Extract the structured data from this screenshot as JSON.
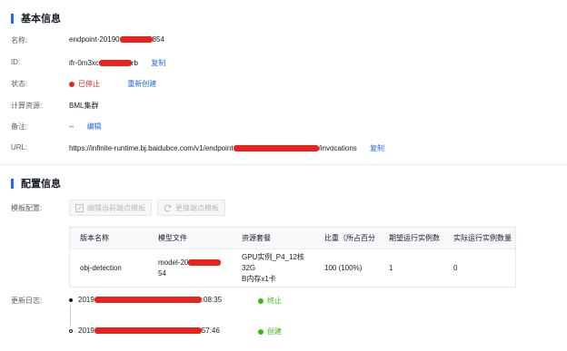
{
  "basic": {
    "title": "基本信息",
    "name_label": "名称:",
    "name_prefix": "endpoint-20190",
    "name_suffix": "854",
    "id_label": "ID:",
    "id_prefix": "ifr-0m3xc",
    "id_suffix": "rb",
    "copy_label": "复制",
    "status_label": "状态:",
    "status_value": "已停止",
    "status_color": "#e8231e",
    "recreate_label": "重新创建",
    "compute_label": "计算资源:",
    "compute_value": "BML集群",
    "remark_label": "备注:",
    "remark_value": "--",
    "edit_label": "编辑",
    "url_label": "URL:",
    "url_prefix": "https://infinite-runtime.bj.baidubce.com/v1/endpoint",
    "url_suffix": "/invocations",
    "url_copy_label": "复制"
  },
  "config": {
    "title": "配置信息",
    "template_label": "模板配置:",
    "edit_template_button": "编辑当前端点模板",
    "edit_template_icon": "edit-icon",
    "change_template_button": "更换端点模板",
    "change_template_icon": "refresh-icon",
    "table": {
      "headers": [
        "版本名称",
        "模型文件",
        "资源套餐",
        "比重（所占百分",
        "期望运行实例数",
        "实际运行实例数量"
      ],
      "rows": [
        {
          "version": "obj-detection",
          "model_prefix": "model-20",
          "model_suffix": "54",
          "resource_line1": "GPU实例_P4_12核32G",
          "resource_line2": "B内存x1卡",
          "weight": "100 (100%)",
          "expected": "1",
          "actual": "0"
        }
      ]
    }
  },
  "log": {
    "label": "更新日志:",
    "entries": [
      {
        "time_prefix": "2019",
        "time_suffix": ":08:35",
        "status": "终止",
        "status_color": "#30bf13"
      },
      {
        "time_prefix": "2019",
        "time_suffix": "57:46",
        "status": "创建",
        "status_color": "#30bf13"
      }
    ]
  },
  "accent_color": "#2468f2",
  "redaction_color": "#e8231e"
}
